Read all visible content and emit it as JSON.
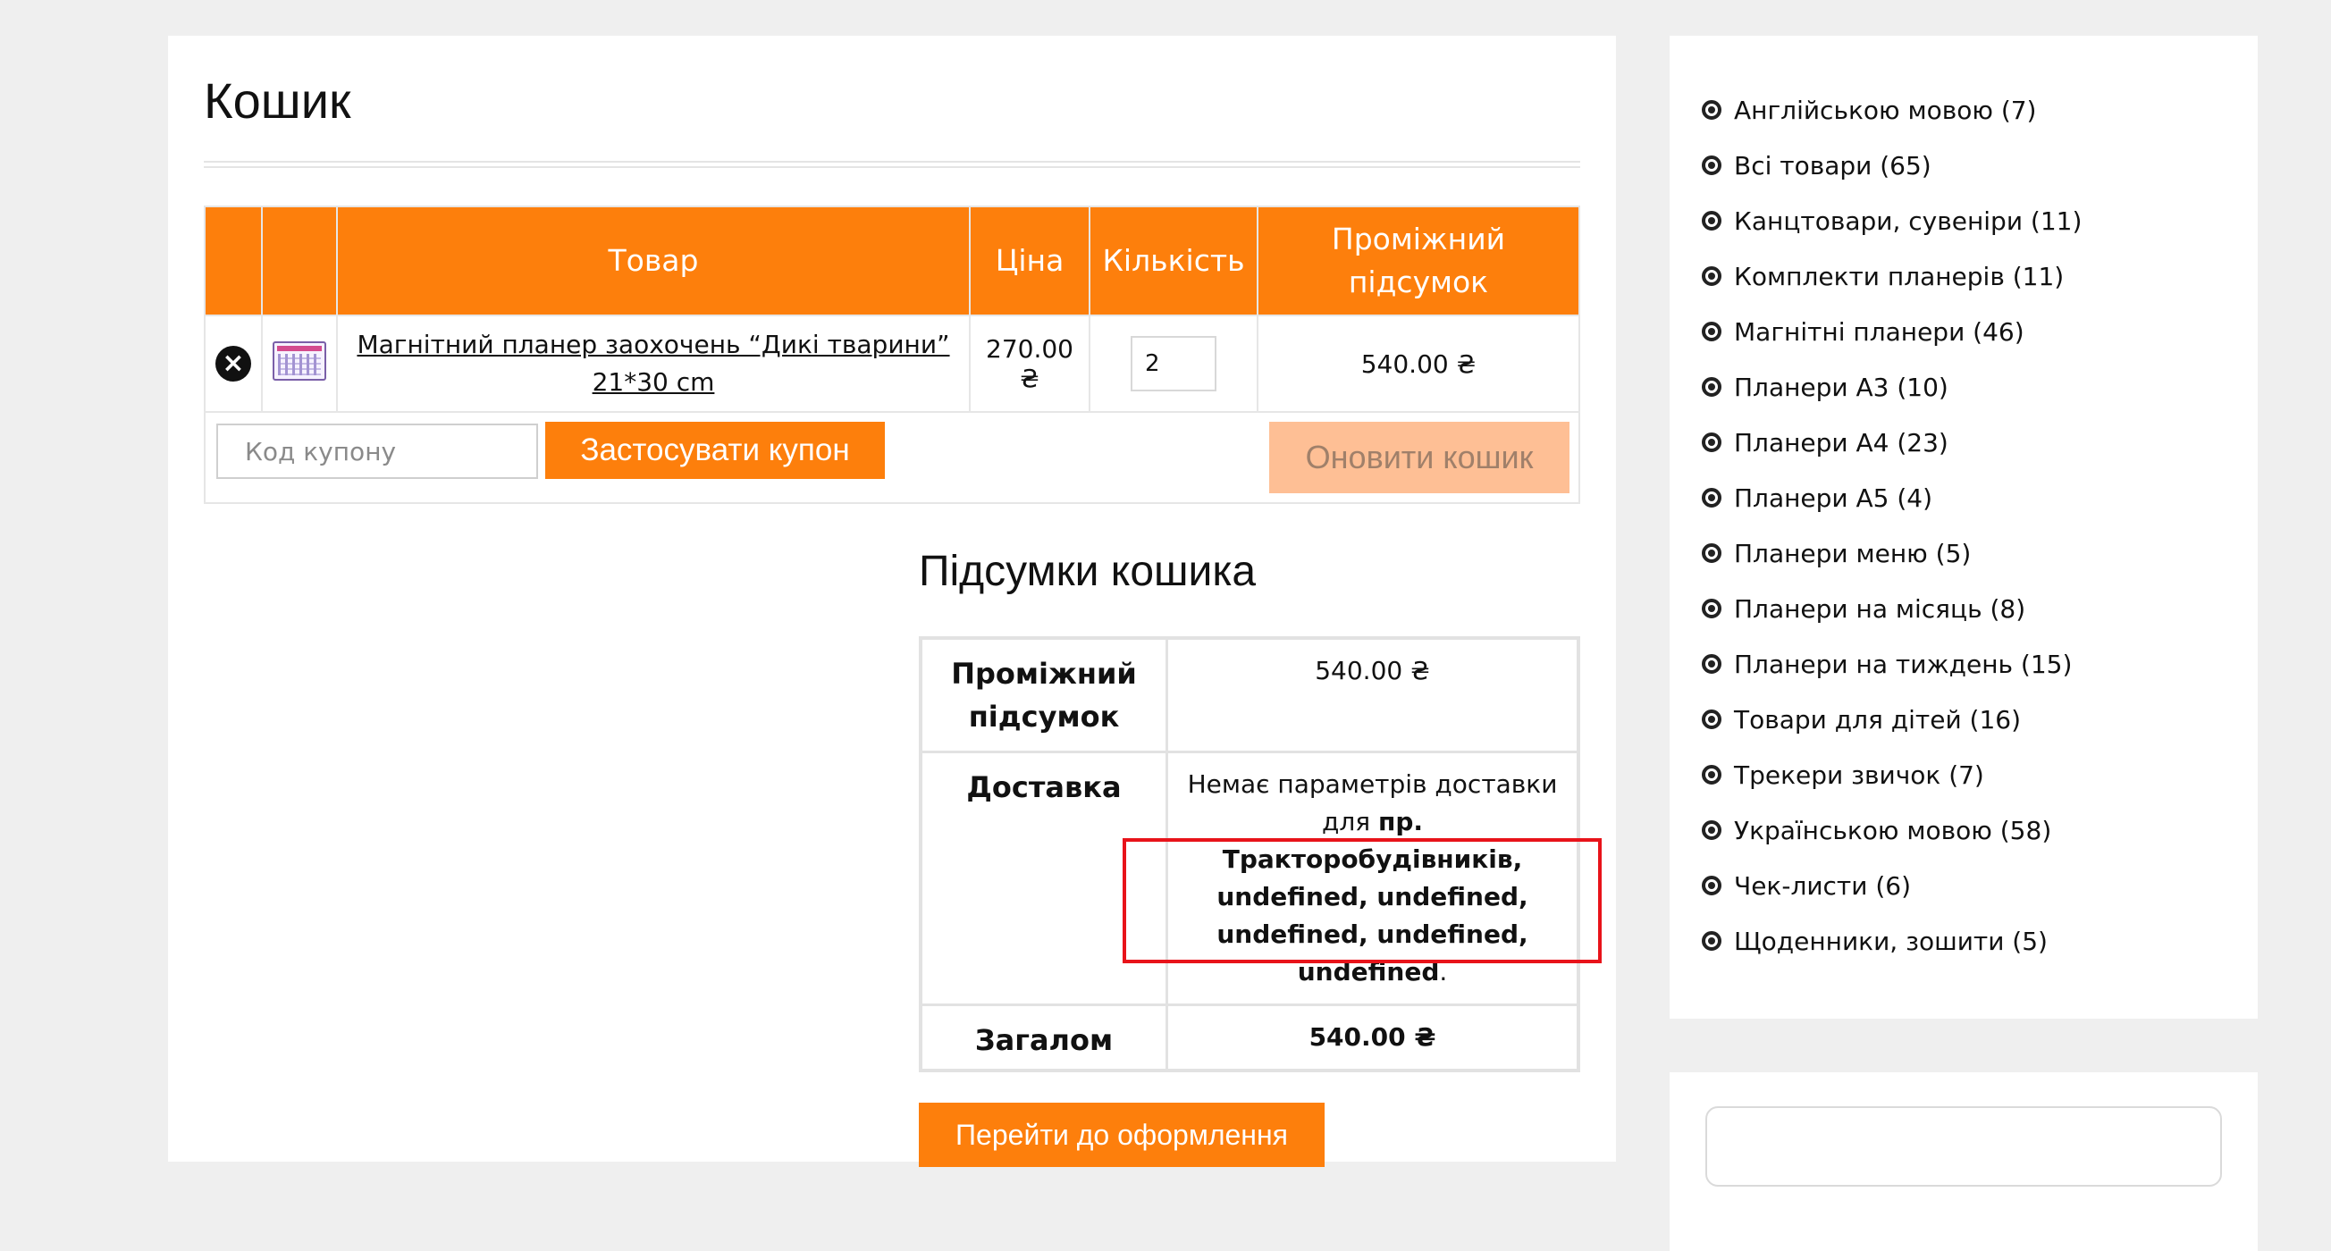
{
  "page": {
    "title": "Кошик"
  },
  "cart": {
    "headers": {
      "product": "Товар",
      "price": "Ціна",
      "quantity": "Кількість",
      "subtotal": "Проміжний підсумок"
    },
    "items": [
      {
        "name": "Магнітний планер заохочень “Дикі тварини” 21*30 cm",
        "price": "270.00 ₴",
        "quantity": "2",
        "subtotal": "540.00 ₴"
      }
    ],
    "remove_icon": "close-circle-icon",
    "coupon": {
      "placeholder": "Код купону",
      "apply_label": "Застосувати купон"
    },
    "update_label": "Оновити кошик"
  },
  "totals": {
    "title": "Підсумки кошика",
    "subtotal_label": "Проміжний підсумок",
    "subtotal_value": "540.00 ₴",
    "shipping_label": "Доставка",
    "shipping_text": "Немає параметрів доставки для",
    "shipping_address": "пр. Тракторобудівників, undefined, undefined, undefined, undefined, undefined",
    "shipping_end": ".",
    "total_label": "Загалом",
    "total_value": "540.00 ₴",
    "checkout_label": "Перейти до оформлення"
  },
  "sidebar": {
    "bullet_icon": "circle-dot-icon",
    "categories": [
      "Англійською мовою (7)",
      "Всі товари (65)",
      "Канцтовари, сувеніри (11)",
      "Комплекти планерів (11)",
      "Магнітні планери (46)",
      "Планери А3 (10)",
      "Планери А4 (23)",
      "Планери А5 (4)",
      "Планери меню (5)",
      "Планери на місяць (8)",
      "Планери на тиждень (15)",
      "Товари для дітей (16)",
      "Трекери звичок (7)",
      "Українською мовою (58)",
      "Чек-листи (6)",
      "Щоденники, зошити (5)"
    ]
  },
  "colors": {
    "accent": "#fd7f0c",
    "accent_disabled": "#febf95",
    "highlight": "#e8131a",
    "background": "#efefef"
  }
}
